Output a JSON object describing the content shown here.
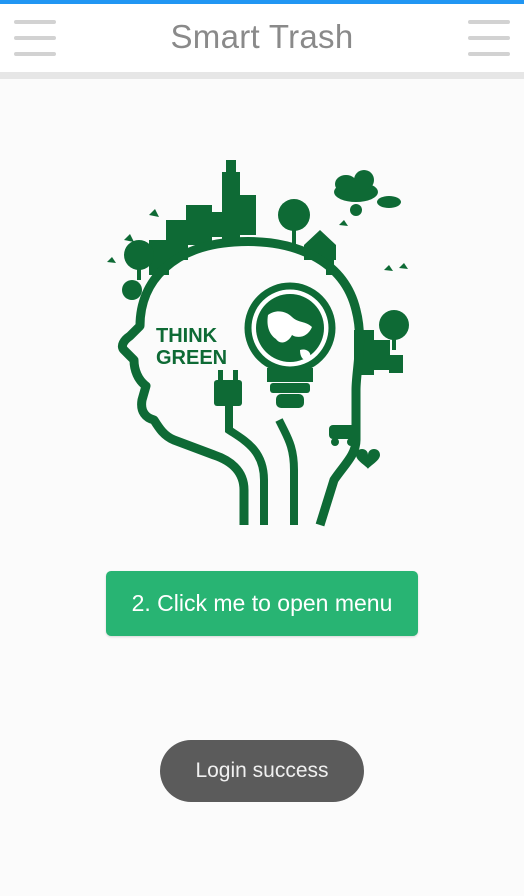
{
  "header": {
    "title": "Smart Trash",
    "left_icon": "hamburger-menu-icon",
    "right_icon": "hamburger-menu-icon"
  },
  "logo": {
    "line1": "THINK",
    "line2": "GREEN"
  },
  "main": {
    "button_label": "2. Click me to open menu"
  },
  "toast": {
    "message": "Login success"
  },
  "colors": {
    "accent": "#28b473",
    "logo_green": "#0e6a35",
    "status_bar": "#2196f3",
    "toast_bg": "#5b5b5b"
  }
}
